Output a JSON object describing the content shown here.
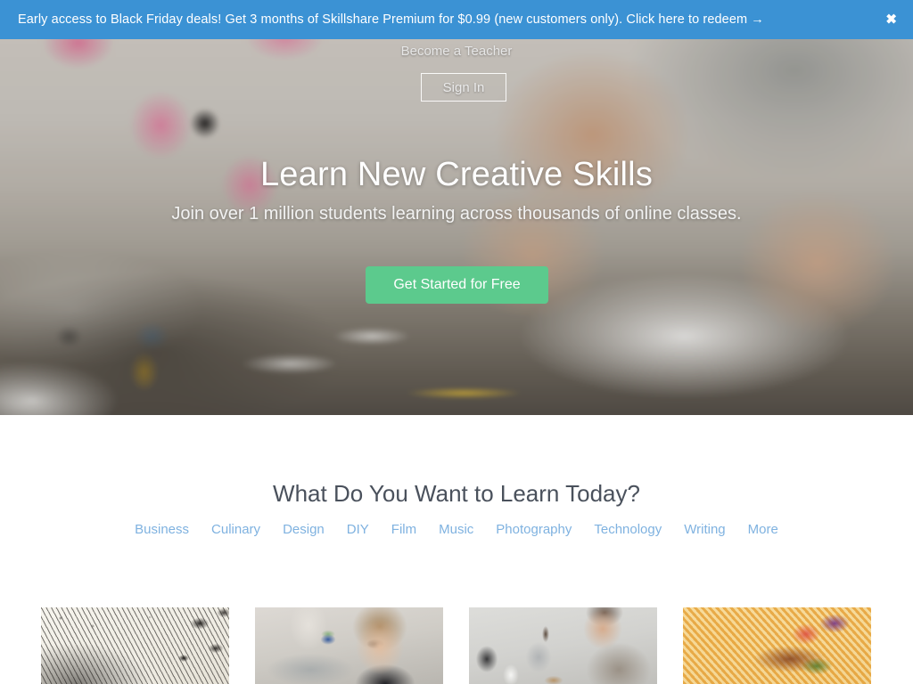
{
  "banner": {
    "text": "Early access to Black Friday deals! Get 3 months of Skillshare Premium for $0.99 (new customers only). Click here to redeem →",
    "close_icon": "close-icon",
    "close_glyph": "✖",
    "background_color": "#3b92d4",
    "text_color": "#ffffff"
  },
  "header": {
    "become_teacher_label": "Become a Teacher",
    "sign_in_label": "Sign In"
  },
  "hero": {
    "title": "Learn New Creative Skills",
    "subtitle": "Join over 1 million students learning across thousands of online classes.",
    "cta_label": "Get Started for Free",
    "cta_color": "#5cca8d",
    "photo_description": "blurred photo of hands sketching on a sketchpad at a desk with markers"
  },
  "learn_section": {
    "title": "What Do You Want to Learn Today?",
    "title_color": "#4a515c",
    "link_color": "#7fb2e0",
    "categories": [
      {
        "label": "Business"
      },
      {
        "label": "Culinary"
      },
      {
        "label": "Design"
      },
      {
        "label": "DIY"
      },
      {
        "label": "Film"
      },
      {
        "label": "Music"
      },
      {
        "label": "Photography"
      },
      {
        "label": "Technology"
      },
      {
        "label": "Writing"
      },
      {
        "label": "More"
      }
    ],
    "cards": [
      {
        "thumb": "ink-wave-drawing-thumbnail"
      },
      {
        "thumb": "woman-with-glasses-thumbnail"
      },
      {
        "thumb": "coffee-brewing-thumbnail"
      },
      {
        "thumb": "burger-and-fries-thumbnail"
      }
    ]
  }
}
